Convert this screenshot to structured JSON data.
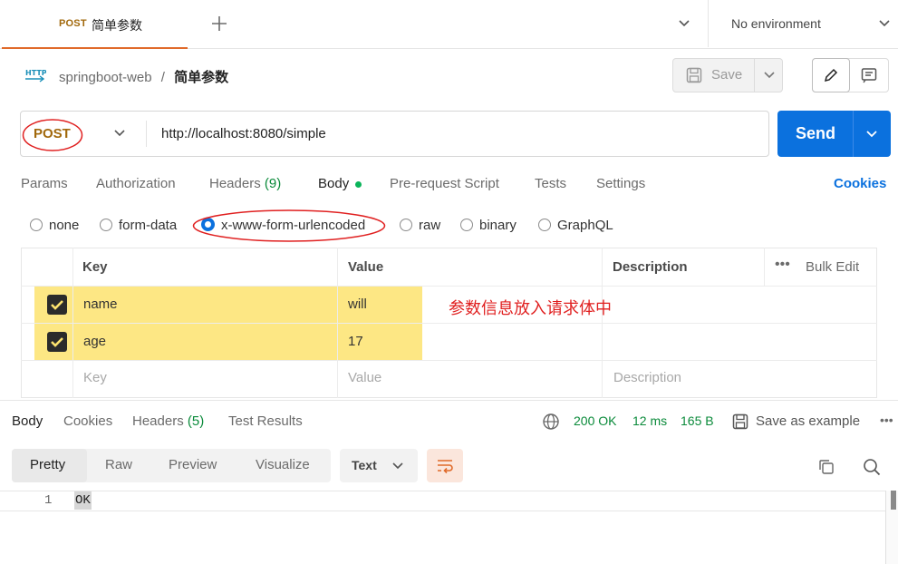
{
  "tab": {
    "method": "POST",
    "name": "简单参数"
  },
  "environment": {
    "label": "No environment"
  },
  "breadcrumb": {
    "collection": "springboot-web",
    "separator": "/",
    "request": "简单参数"
  },
  "toolbar": {
    "save_label": "Save"
  },
  "request": {
    "method": "POST",
    "url": "http://localhost:8080/simple",
    "send_label": "Send"
  },
  "request_tabs": [
    "Params",
    "Authorization",
    "Headers",
    "(9)",
    "Body",
    "Pre-request Script",
    "Tests",
    "Settings"
  ],
  "cookies_link": "Cookies",
  "body_types": [
    "none",
    "form-data",
    "x-www-form-urlencoded",
    "raw",
    "binary",
    "GraphQL"
  ],
  "table": {
    "headers": {
      "key": "Key",
      "value": "Value",
      "description": "Description",
      "bulk_edit": "Bulk Edit"
    },
    "rows": [
      {
        "key": "name",
        "value": "will"
      },
      {
        "key": "age",
        "value": "17"
      }
    ],
    "placeholder": {
      "key": "Key",
      "value": "Value",
      "description": "Description"
    }
  },
  "annotation": "参数信息放入请求体中",
  "response_tabs": {
    "body": "Body",
    "cookies": "Cookies",
    "headers": "Headers",
    "headers_count": "(5)",
    "tests": "Test Results"
  },
  "response_meta": {
    "status": "200 OK",
    "time": "12 ms",
    "size": "165 B",
    "save_example": "Save as example"
  },
  "view_modes": [
    "Pretty",
    "Raw",
    "Preview",
    "Visualize"
  ],
  "format": "Text",
  "code": {
    "line_number": "1",
    "content": "OK"
  },
  "colors": {
    "accent": "#e06a2a",
    "send": "#0b71de",
    "method": "#a1680b",
    "success": "#0a8a3a",
    "annotation_red": "#e02020",
    "highlight": "#fde36f"
  }
}
